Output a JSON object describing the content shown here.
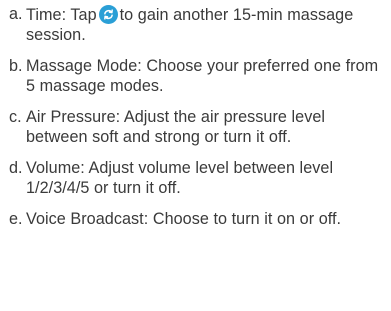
{
  "items": [
    {
      "letter": "a.",
      "text_before_icon": "Time: Tap",
      "icon": "refresh-timer-icon",
      "icon_color": "#2a9fd6",
      "text_after_icon": "to gain another 15-min massage session."
    },
    {
      "letter": "b.",
      "text": "Massage Mode: Choose your preferred one from 5 massage modes."
    },
    {
      "letter": "c.",
      "text": "Air Pressure: Adjust the air pressure level between soft and strong or turn it off."
    },
    {
      "letter": "d.",
      "text": "Volume: Adjust volume level between level 1/2/3/4/5 or turn it off."
    },
    {
      "letter": "e.",
      "text": "Voice Broadcast: Choose to turn it on or off."
    }
  ]
}
